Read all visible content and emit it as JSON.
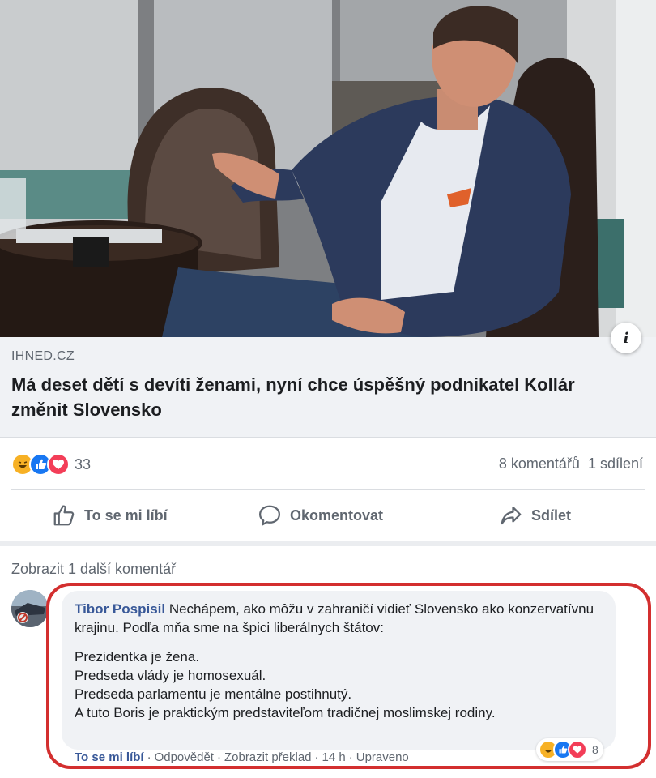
{
  "photo": {
    "alt_icon": "info-icon"
  },
  "link_preview": {
    "domain": "IHNED.CZ",
    "title": "Má deset dětí s devíti ženami, nyní chce úspěšný podnikatel Kollár změnit Slovensko"
  },
  "stats": {
    "reaction_icons": [
      "haha-icon",
      "like-icon",
      "love-icon"
    ],
    "reaction_count": "33",
    "comments": "8 komentářů",
    "shares": "1 sdílení"
  },
  "actions": {
    "like": "To se mi líbí",
    "comment": "Okomentovat",
    "share": "Sdílet"
  },
  "comments_section": {
    "show_more": "Zobrazit 1 další komentář",
    "comment": {
      "author": "Tibor Pospisil",
      "text_intro": "Nechápem, ako môžu v zahraničí vidieť Slovensko ako konzervatívnu krajinu. Podľa mňa sme na špici liberálnych štátov:",
      "lines": [
        "Prezidentka je žena.",
        "Predseda vlády je homosexuál.",
        "Predseda parlamentu je mentálne postihnutý.",
        "A tuto Boris je praktickým predstaviteľom tradičnej moslimskej rodiny."
      ],
      "reaction_count": "8",
      "meta": {
        "like": "To se mi líbí",
        "reply": "Odpovědět",
        "translate": "Zobrazit překlad",
        "time": "14 h",
        "edited": "Upraveno"
      }
    }
  },
  "colors": {
    "link_blue": "#385898",
    "gray_text": "#606770",
    "highlight_red": "#d32f2f",
    "like_blue": "#1877f2",
    "love_red": "#f33e58",
    "haha_yellow": "#f7b125"
  }
}
